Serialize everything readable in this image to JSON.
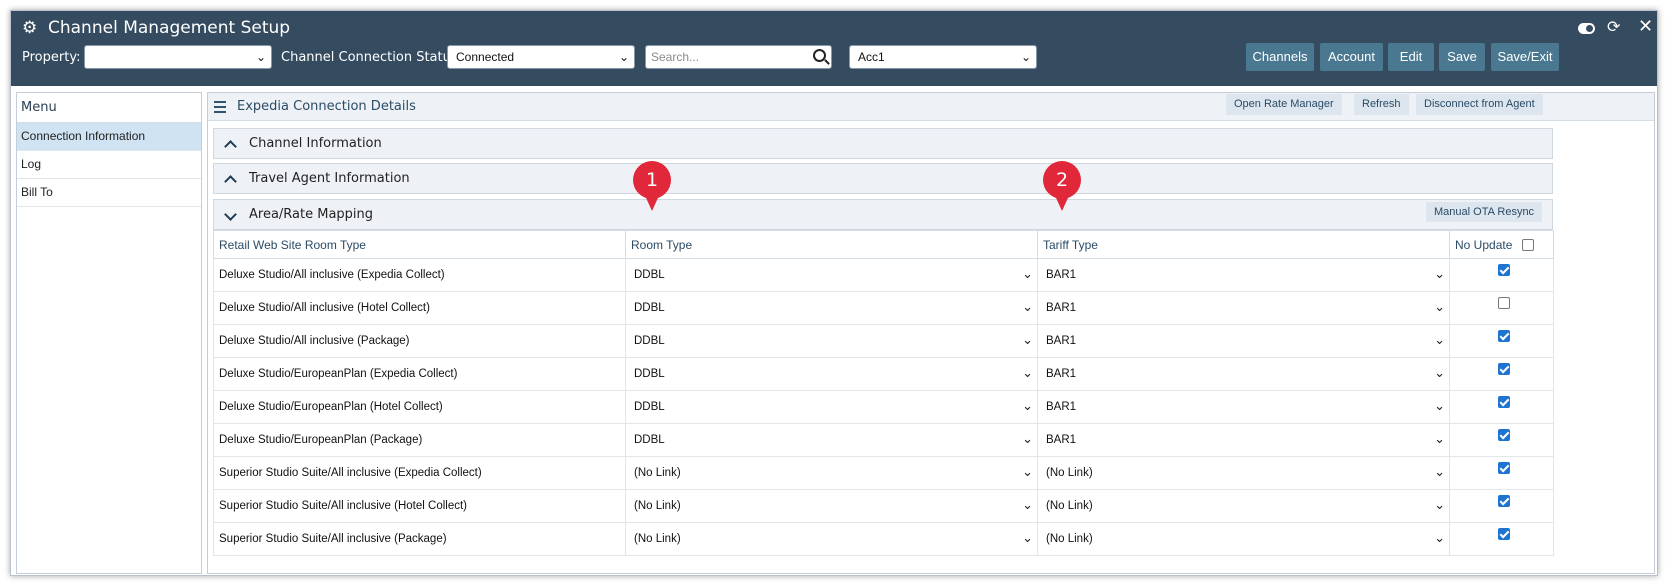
{
  "window": {
    "title": "Channel Management Setup"
  },
  "toolbar": {
    "property_label": "Property:",
    "property_value": "",
    "status_label": "Channel Connection Status:",
    "status_value": "Connected",
    "search_placeholder": "Search...",
    "account_value": "Acc1",
    "buttons": [
      "Channels",
      "Account",
      "Edit",
      "Save",
      "Save/Exit"
    ]
  },
  "sidebar": {
    "heading": "Menu",
    "items": [
      "Connection Information",
      "Log",
      "Bill To"
    ],
    "active_index": 0
  },
  "main": {
    "title": "Expedia Connection Details",
    "header_buttons": [
      "Open Rate Manager",
      "Refresh",
      "Disconnect from Agent"
    ],
    "sections": [
      {
        "title": "Channel Information",
        "expanded": false
      },
      {
        "title": "Travel Agent Information",
        "expanded": false
      },
      {
        "title": "Area/Rate Mapping",
        "expanded": true
      }
    ],
    "resync_button": "Manual OTA Resync"
  },
  "table": {
    "columns": [
      "Retail Web Site Room Type",
      "Room Type",
      "Tariff Type",
      "No Update"
    ],
    "no_update_all_checked": false,
    "rows": [
      {
        "retail": "Deluxe Studio/All inclusive (Expedia Collect)",
        "room": "DDBL",
        "tariff": "BAR1",
        "no_update": true
      },
      {
        "retail": "Deluxe Studio/All inclusive (Hotel Collect)",
        "room": "DDBL",
        "tariff": "BAR1",
        "no_update": false
      },
      {
        "retail": "Deluxe Studio/All inclusive (Package)",
        "room": "DDBL",
        "tariff": "BAR1",
        "no_update": true
      },
      {
        "retail": "Deluxe Studio/EuropeanPlan (Expedia Collect)",
        "room": "DDBL",
        "tariff": "BAR1",
        "no_update": true
      },
      {
        "retail": "Deluxe Studio/EuropeanPlan (Hotel Collect)",
        "room": "DDBL",
        "tariff": "BAR1",
        "no_update": true
      },
      {
        "retail": "Deluxe Studio/EuropeanPlan (Package)",
        "room": "DDBL",
        "tariff": "BAR1",
        "no_update": true
      },
      {
        "retail": "Superior Studio Suite/All inclusive (Expedia Collect)",
        "room": "(No Link)",
        "tariff": "(No Link)",
        "no_update": true
      },
      {
        "retail": "Superior Studio Suite/All inclusive (Hotel Collect)",
        "room": "(No Link)",
        "tariff": "(No Link)",
        "no_update": true
      },
      {
        "retail": "Superior Studio Suite/All inclusive (Package)",
        "room": "(No Link)",
        "tariff": "(No Link)",
        "no_update": true
      }
    ]
  },
  "callouts": [
    "1",
    "2"
  ],
  "icons": {
    "title": "gears-icon",
    "toggle": "toggle-icon",
    "refresh": "refresh-icon",
    "close": "close-icon",
    "search": "search-icon",
    "menu": "hamburger-icon"
  },
  "colors": {
    "titlebar": "#344b60",
    "button": "#4a7891",
    "active_menu": "#cfe3f3",
    "callout": "#e0283a",
    "checkbox": "#1f74d1"
  }
}
